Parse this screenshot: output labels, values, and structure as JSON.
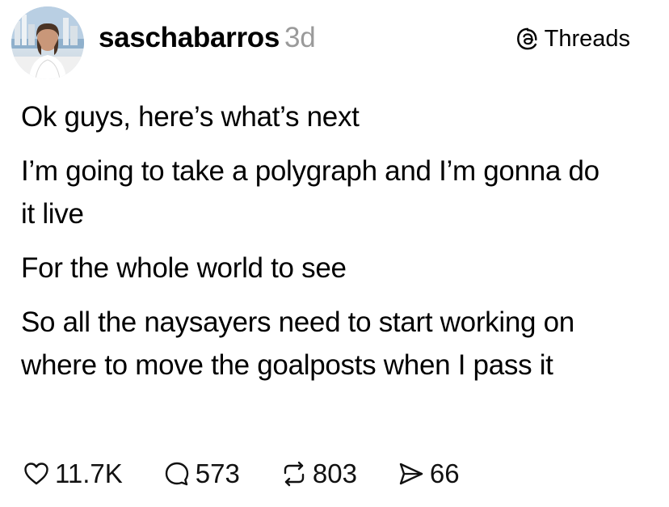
{
  "header": {
    "username": "saschabarros",
    "time": "3d",
    "brand": "Threads",
    "brand_icon": "threads-icon",
    "avatar": "profile-photo"
  },
  "post": {
    "paragraphs": [
      "Ok guys, here’s what’s next",
      "I’m going to take a polygraph and I’m gonna do it live",
      "For the whole world to see",
      "So all the naysayers need to start working on where to move the goalposts when I pass it"
    ]
  },
  "actions": {
    "likes": "11.7K",
    "replies": "573",
    "reposts": "803",
    "shares": "66",
    "icons": [
      "heart-icon",
      "comment-icon",
      "repost-icon",
      "send-icon"
    ]
  }
}
